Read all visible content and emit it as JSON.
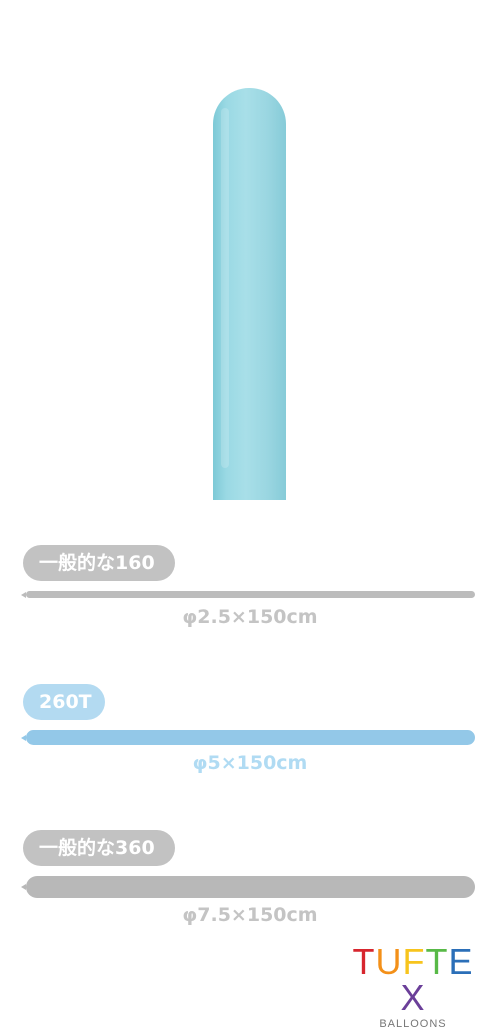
{
  "colors": {
    "balloon": "#9ad9e4",
    "gray": "#bcbcbc",
    "gray_text": "#c4c4c4",
    "blue": "#93c8e8",
    "blue_pill": "#b3daf1",
    "blue_text": "#b0dbf3"
  },
  "sizes": [
    {
      "label": "一般的な160",
      "dimension": "φ2.5×150cm"
    },
    {
      "label": "260T",
      "dimension": "φ5×150cm"
    },
    {
      "label": "一般的な360",
      "dimension": "φ7.5×150cm"
    }
  ],
  "brand": {
    "letters": [
      {
        "char": "T",
        "color": "#d7262e"
      },
      {
        "char": "U",
        "color": "#f39019"
      },
      {
        "char": "F",
        "color": "#f7c41d"
      },
      {
        "char": "T",
        "color": "#58b947"
      },
      {
        "char": "E",
        "color": "#2b6fb8"
      },
      {
        "char": "X",
        "color": "#6b3f99"
      }
    ],
    "subtitle": "BALLOONS"
  }
}
